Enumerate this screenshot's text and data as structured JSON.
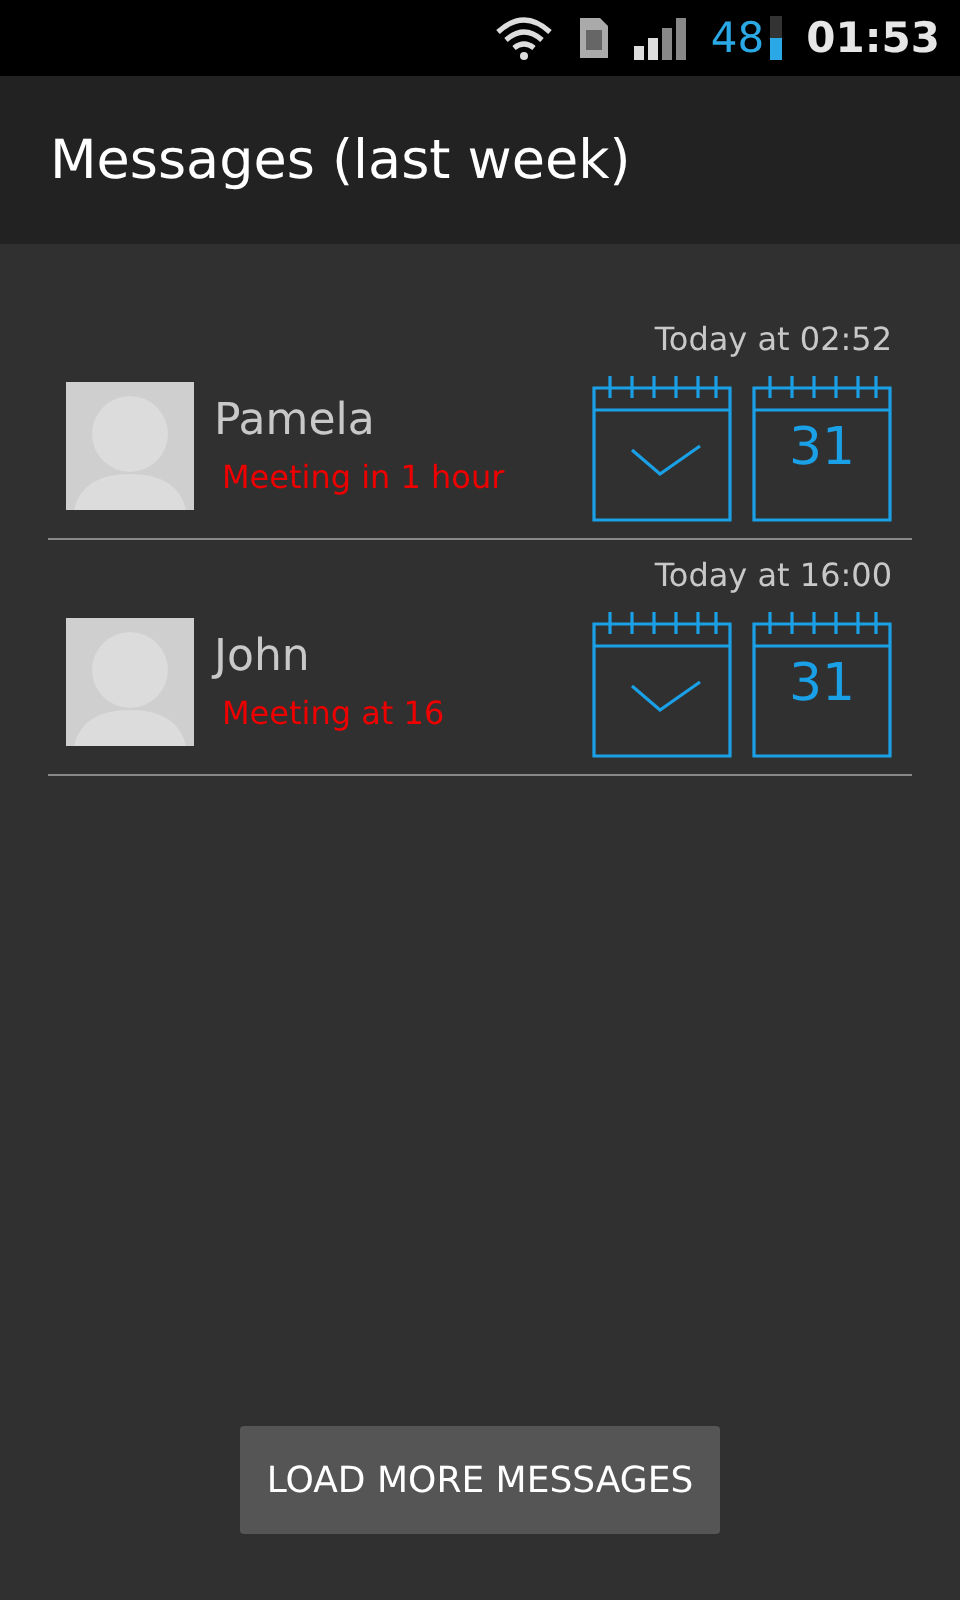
{
  "status_bar": {
    "battery": "48",
    "time": "01:53"
  },
  "action_bar": {
    "title": "Messages (last week)"
  },
  "messages": [
    {
      "time": "Today at 02:52",
      "name": "Pamela",
      "text": "Meeting in 1 hour",
      "calendar_day": "31"
    },
    {
      "time": "Today at 16:00",
      "name": "John",
      "text": "Meeting at 16",
      "calendar_day": "31"
    }
  ],
  "load_more_button": "LOAD MORE MESSAGES"
}
